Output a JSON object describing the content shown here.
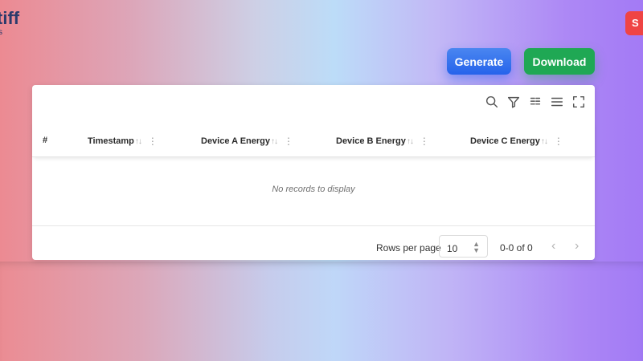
{
  "brand": {
    "name": "tiff",
    "sub": "s"
  },
  "corner_button": {
    "label": "S"
  },
  "actions": {
    "generate": "Generate",
    "download": "Download"
  },
  "table": {
    "columns": [
      "#",
      "Timestamp",
      "Device A Energy",
      "Device B Energy",
      "Device C Energy"
    ],
    "empty_message": "No records to display",
    "sort_glyph": "↑↓",
    "menu_glyph": "⋮"
  },
  "pagination": {
    "rows_per_page_label": "Rows per page",
    "rows_per_page_value": "10",
    "page_info": "0-0 of 0",
    "prev": "‹",
    "next": "›"
  },
  "toolbar_icons": [
    "search-icon",
    "filter-icon",
    "columns-icon",
    "density-icon",
    "fullscreen-icon"
  ],
  "colors": {
    "generate": "#2563eb",
    "download": "#1fa854",
    "danger": "#ef4444"
  }
}
